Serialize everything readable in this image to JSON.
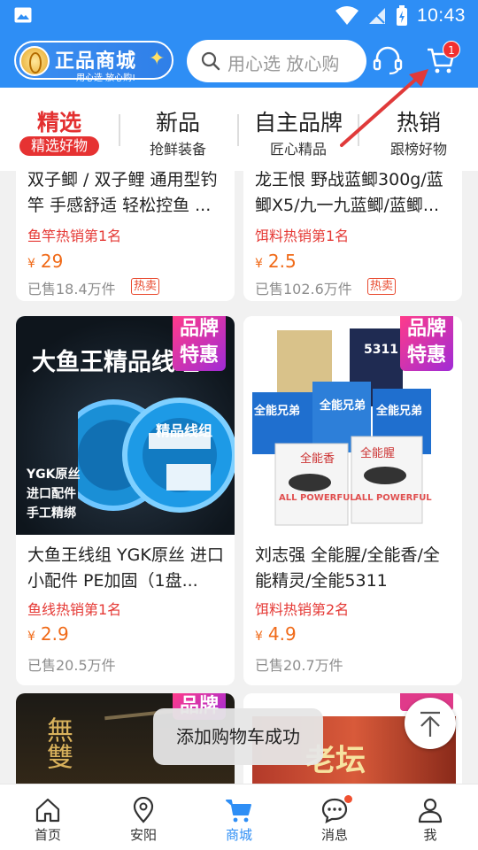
{
  "status_bar": {
    "time": "10:43"
  },
  "header": {
    "logo_title": "正品商城",
    "logo_sub": "用心选 放心购!",
    "search_placeholder": "用心选 放心购",
    "cart_badge": "1"
  },
  "categories": [
    {
      "title": "精选",
      "sub": "精选好物",
      "active": true
    },
    {
      "title": "新品",
      "sub": "抢鲜装备",
      "active": false
    },
    {
      "title": "自主品牌",
      "sub": "匠心精品",
      "active": false
    },
    {
      "title": "热销",
      "sub": "跟榜好物",
      "active": false
    }
  ],
  "products": [
    {
      "title": "双子鲫 / 双子鲤 通用型钓竿 手感舒适 轻松控鱼 ...",
      "rank": "鱼竿热销第1名",
      "price": "29",
      "sold": "已售18.4万件",
      "tag": "热卖"
    },
    {
      "title": "龙王恨 野战蓝鲫300g/蓝鲫X5/九一九蓝鲫/蓝鲫...",
      "rank": "饵料热销第1名",
      "price": "2.5",
      "sold": "已售102.6万件",
      "tag": "热卖"
    },
    {
      "title": "大鱼王线组 YGK原丝 进口小配件 PE加固（1盘...",
      "rank": "鱼线热销第1名",
      "price": "2.9",
      "sold": "已售20.5万件",
      "img_headline": "大鱼王精品线组",
      "img_bullets": [
        "YGK原丝",
        "进口配件",
        "手工精绑"
      ],
      "brand_tag": "品牌特惠",
      "spool_label": "精品线组"
    },
    {
      "title": "刘志强 全能腥/全能香/全能精灵/全能5311",
      "rank": "饵料热销第2名",
      "price": "4.9",
      "sold": "已售20.7万件",
      "brand_tag": "品牌特惠",
      "pack_labels": [
        "全能兄弟",
        "全能香",
        "全能腥",
        "ALL POWERFUL",
        "5311"
      ]
    },
    {
      "brand_tag": "品牌",
      "img_text": "無雙"
    },
    {
      "img_text": "老坛"
    }
  ],
  "currency": "¥",
  "toast": "添加购物车成功",
  "bottom_nav": [
    {
      "label": "首页",
      "icon": "home-icon",
      "active": false
    },
    {
      "label": "安阳",
      "icon": "location-icon",
      "active": false
    },
    {
      "label": "商城",
      "icon": "cart-icon",
      "active": true
    },
    {
      "label": "消息",
      "icon": "message-icon",
      "active": false
    },
    {
      "label": "我",
      "icon": "user-icon",
      "active": false
    }
  ],
  "colors": {
    "primary": "#2e8ef5",
    "accent_red": "#e33030",
    "price_orange": "#f06a18",
    "arrow": "#e03a3a"
  }
}
